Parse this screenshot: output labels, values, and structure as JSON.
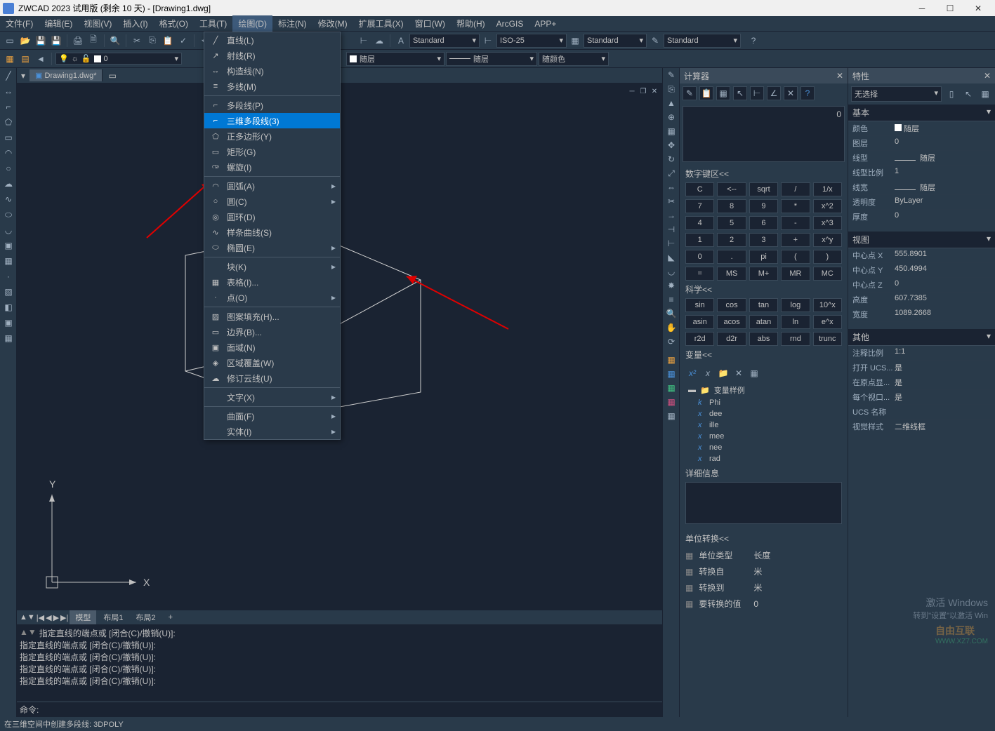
{
  "titlebar": {
    "title": "ZWCAD 2023 试用版 (剩余 10 天) - [Drawing1.dwg]"
  },
  "menubar": [
    "文件(F)",
    "编辑(E)",
    "视图(V)",
    "插入(I)",
    "格式(O)",
    "工具(T)",
    "绘图(D)",
    "标注(N)",
    "修改(M)",
    "扩展工具(X)",
    "窗口(W)",
    "帮助(H)",
    "ArcGIS",
    "APP+"
  ],
  "active_menu_index": 6,
  "toolbar1": {
    "combos": [
      {
        "label": "Standard"
      },
      {
        "label": "ISO-25"
      },
      {
        "label": "Standard"
      },
      {
        "label": "Standard"
      }
    ]
  },
  "toolbar2": {
    "layer_name": "0",
    "linetype": "随层",
    "linetype2": "随层",
    "color": "随颜色"
  },
  "doc_tab": "Drawing1.dwg*",
  "dropdown": [
    {
      "type": "item",
      "label": "直线(L)",
      "icon": "╱"
    },
    {
      "type": "item",
      "label": "射线(R)",
      "icon": "↗"
    },
    {
      "type": "item",
      "label": "构造线(N)",
      "icon": "↔"
    },
    {
      "type": "item",
      "label": "多线(M)",
      "icon": "≡"
    },
    {
      "type": "sep"
    },
    {
      "type": "item",
      "label": "多段线(P)",
      "icon": "⌐"
    },
    {
      "type": "item",
      "label": "三维多段线(3)",
      "icon": "⌐",
      "highlighted": true
    },
    {
      "type": "item",
      "label": "正多边形(Y)",
      "icon": "⬠"
    },
    {
      "type": "item",
      "label": "矩形(G)",
      "icon": "▭"
    },
    {
      "type": "item",
      "label": "螺旋(I)",
      "icon": "ꩠ"
    },
    {
      "type": "sep"
    },
    {
      "type": "item",
      "label": "圆弧(A)",
      "icon": "◠",
      "sub": true
    },
    {
      "type": "item",
      "label": "圆(C)",
      "icon": "○",
      "sub": true
    },
    {
      "type": "item",
      "label": "圆环(D)",
      "icon": "◎"
    },
    {
      "type": "item",
      "label": "样条曲线(S)",
      "icon": "∿"
    },
    {
      "type": "item",
      "label": "椭圆(E)",
      "icon": "⬭",
      "sub": true
    },
    {
      "type": "sep"
    },
    {
      "type": "item",
      "label": "块(K)",
      "icon": "",
      "sub": true
    },
    {
      "type": "item",
      "label": "表格(I)...",
      "icon": "▦"
    },
    {
      "type": "item",
      "label": "点(O)",
      "icon": "·",
      "sub": true
    },
    {
      "type": "sep"
    },
    {
      "type": "item",
      "label": "图案填充(H)...",
      "icon": "▨"
    },
    {
      "type": "item",
      "label": "边界(B)...",
      "icon": "▭"
    },
    {
      "type": "item",
      "label": "面域(N)",
      "icon": "▣"
    },
    {
      "type": "item",
      "label": "区域覆盖(W)",
      "icon": "◈"
    },
    {
      "type": "item",
      "label": "修订云线(U)",
      "icon": "☁"
    },
    {
      "type": "sep"
    },
    {
      "type": "item",
      "label": "文字(X)",
      "icon": "",
      "sub": true
    },
    {
      "type": "sep"
    },
    {
      "type": "item",
      "label": "曲面(F)",
      "icon": "",
      "sub": true
    },
    {
      "type": "item",
      "label": "实体(I)",
      "icon": "",
      "sub": true
    }
  ],
  "calculator": {
    "title": "计算器",
    "number_keys_title": "数字键区<<",
    "keys": [
      [
        "C",
        "<--",
        "sqrt",
        "/",
        "1/x"
      ],
      [
        "7",
        "8",
        "9",
        "*",
        "x^2"
      ],
      [
        "4",
        "5",
        "6",
        "-",
        "x^3"
      ],
      [
        "1",
        "2",
        "3",
        "+",
        "x^y"
      ],
      [
        "0",
        ".",
        "pi",
        "(",
        ")"
      ],
      [
        "=",
        "MS",
        "M+",
        "MR",
        "MC"
      ]
    ],
    "science_title": "科学<<",
    "science_keys": [
      [
        "sin",
        "cos",
        "tan",
        "log",
        "10^x"
      ],
      [
        "asin",
        "acos",
        "atan",
        "ln",
        "e^x"
      ],
      [
        "r2d",
        "d2r",
        "abs",
        "rnd",
        "trunc"
      ]
    ],
    "variables_title": "变量<<",
    "var_folder": "变量样例",
    "variables": [
      "Phi",
      "dee",
      "ille",
      "mee",
      "nee",
      "rad"
    ],
    "details_title": "详细信息",
    "unit_title": "单位转换<<",
    "unit_rows": [
      {
        "label": "单位类型",
        "value": "长度"
      },
      {
        "label": "转换自",
        "value": "米"
      },
      {
        "label": "转换到",
        "value": "米"
      },
      {
        "label": "要转换的值",
        "value": "0"
      }
    ]
  },
  "properties": {
    "title": "特性",
    "selector": "无选择",
    "sections": [
      {
        "name": "基本",
        "rows": [
          {
            "label": "颜色",
            "value": "随层",
            "swatch": true
          },
          {
            "label": "图层",
            "value": "0"
          },
          {
            "label": "线型",
            "value": "随层",
            "line": true
          },
          {
            "label": "线型比例",
            "value": "1"
          },
          {
            "label": "线宽",
            "value": "随层",
            "line": true
          },
          {
            "label": "透明度",
            "value": "ByLayer"
          },
          {
            "label": "厚度",
            "value": "0"
          }
        ]
      },
      {
        "name": "视图",
        "rows": [
          {
            "label": "中心点 X",
            "value": "555.8901"
          },
          {
            "label": "中心点 Y",
            "value": "450.4994"
          },
          {
            "label": "中心点 Z",
            "value": "0"
          },
          {
            "label": "高度",
            "value": "607.7385"
          },
          {
            "label": "宽度",
            "value": "1089.2668"
          }
        ]
      },
      {
        "name": "其他",
        "rows": [
          {
            "label": "注释比例",
            "value": "1:1"
          },
          {
            "label": "打开 UCS...",
            "value": "是"
          },
          {
            "label": "在原点显...",
            "value": "是"
          },
          {
            "label": "每个视口...",
            "value": "是"
          },
          {
            "label": "UCS 名称",
            "value": ""
          },
          {
            "label": "视觉样式",
            "value": "二维线框"
          }
        ]
      }
    ]
  },
  "bottom_tabs": [
    "模型",
    "布局1",
    "布局2"
  ],
  "command_lines": [
    "指定直线的端点或 [闭合(C)/撤销(U)]:",
    "指定直线的端点或 [闭合(C)/撤销(U)]:",
    "指定直线的端点或 [闭合(C)/撤销(U)]:",
    "指定直线的端点或 [闭合(C)/撤销(U)]:",
    "指定直线的端点或 [闭合(C)/撤销(U)]:"
  ],
  "cmd_prompt": "命令:",
  "statusbar": "在三维空间中创建多段线: 3DPOLY",
  "watermark": {
    "line1": "激活 Windows",
    "line2": "转到\"设置\"以激活 Win"
  },
  "watermark2": {
    "text": "自由互联",
    "url": "WWW.XZ7.COM"
  },
  "axis": {
    "x": "X",
    "y": "Y"
  }
}
